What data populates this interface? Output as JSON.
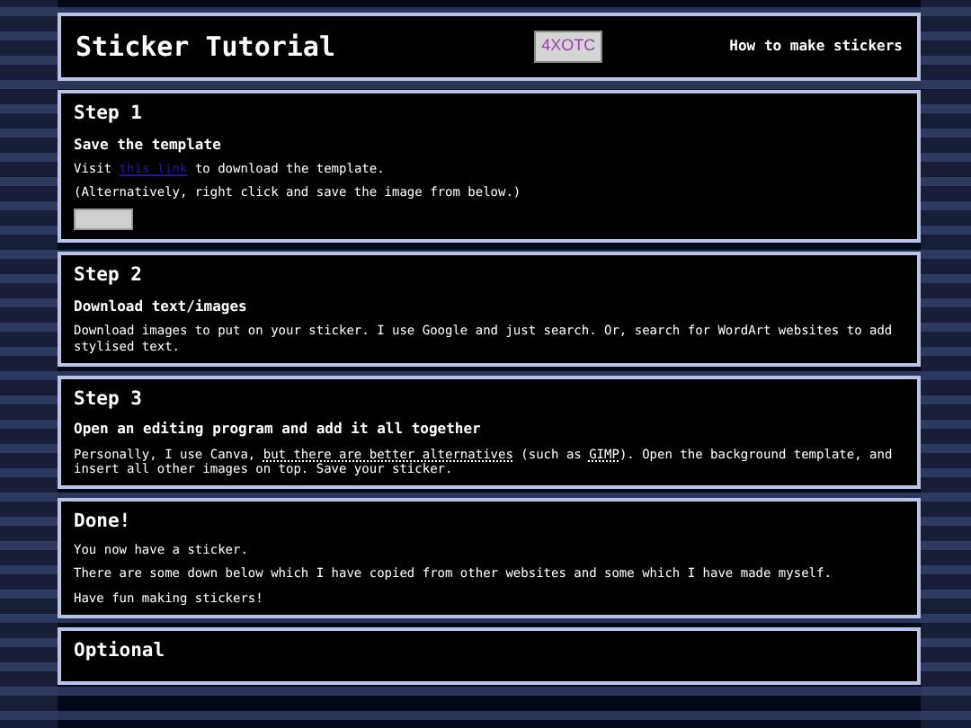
{
  "header": {
    "title": "Sticker Tutorial",
    "logo": "4XOTC",
    "tagline": "How to make stickers"
  },
  "sections": [
    {
      "heading": "Step 1",
      "subheading": "Save the template",
      "paragraphs": [
        [
          {
            "kind": "text",
            "text": "Visit "
          },
          {
            "kind": "link",
            "text": "this link"
          },
          {
            "kind": "text",
            "text": " to download the template."
          }
        ],
        [
          {
            "kind": "text",
            "text": "(Alternatively, right click and save the image from below.)"
          }
        ]
      ],
      "image": true
    },
    {
      "heading": "Step 2",
      "subheading": "Download text/images",
      "paragraphs": [
        [
          {
            "kind": "text",
            "text": "Download images to put on your sticker. I use Google and just search. Or, search for WordArt websites to add stylised text."
          }
        ]
      ]
    },
    {
      "heading": "Step 3",
      "subheading": "Open an editing program and add it all together",
      "paragraphs": [
        [
          {
            "kind": "text",
            "text": "Personally, I use Canva, "
          },
          {
            "kind": "abbr",
            "text": "but there are better alternatives"
          },
          {
            "kind": "text",
            "text": " (such as "
          },
          {
            "kind": "abbr",
            "text": "GIMP"
          },
          {
            "kind": "text",
            "text": "). Open the background template, and insert all other images on top. Save your sticker."
          }
        ]
      ]
    },
    {
      "heading": "Done!",
      "paragraphs": [
        [
          {
            "kind": "text",
            "text": "You now have a sticker."
          }
        ],
        [
          {
            "kind": "text",
            "text": "There are some down below which I have copied from other websites and some which I have made myself."
          }
        ],
        [
          {
            "kind": "text",
            "text": "Have fun making stickers!"
          }
        ]
      ]
    },
    {
      "heading": "Optional"
    }
  ]
}
